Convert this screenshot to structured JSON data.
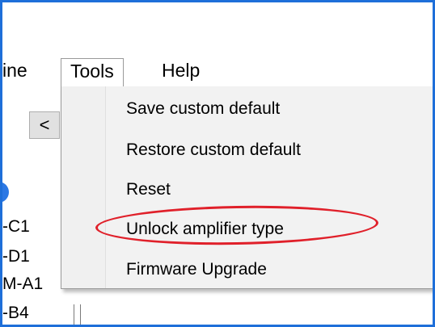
{
  "menubar": {
    "partial_item_label": "ine",
    "tools_label": "Tools",
    "help_label": "Help"
  },
  "left_panel": {
    "nav_button_label": "<",
    "entries": [
      "-C1",
      "-D1",
      "M-A1",
      "-B4"
    ]
  },
  "tools_menu": {
    "items": [
      {
        "label": "Save custom default"
      },
      {
        "label": "Restore custom default"
      },
      {
        "label": "Reset"
      },
      {
        "label": "Unlock amplifier type"
      },
      {
        "label": "Firmware Upgrade"
      }
    ]
  },
  "annotation": {
    "highlighted_item": "Unlock amplifier type",
    "color": "#e0202a"
  },
  "colors": {
    "frame_border": "#1e6fd9",
    "menu_background": "#f2f2f2"
  }
}
